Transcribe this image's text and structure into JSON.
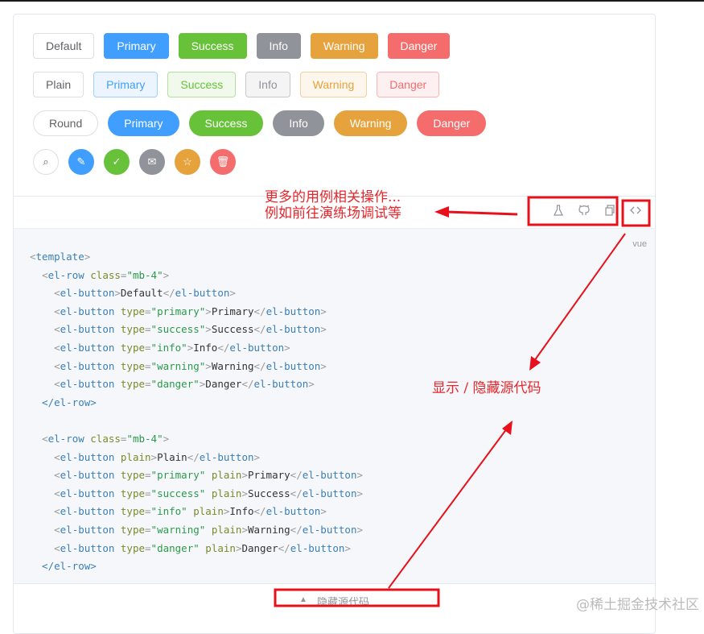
{
  "rows": [
    {
      "kind": "default",
      "buttons": [
        "Default",
        "Primary",
        "Success",
        "Info",
        "Warning",
        "Danger"
      ]
    },
    {
      "kind": "plain",
      "buttons": [
        "Plain",
        "Primary",
        "Success",
        "Info",
        "Warning",
        "Danger"
      ]
    },
    {
      "kind": "round",
      "buttons": [
        "Round",
        "Primary",
        "Success",
        "Info",
        "Warning",
        "Danger"
      ]
    }
  ],
  "circle_icons": [
    "search-icon",
    "edit-icon",
    "check-icon",
    "message-icon",
    "star-icon",
    "delete-icon"
  ],
  "colors": {
    "primary": "#409eff",
    "success": "#67c23a",
    "info": "#909399",
    "warning": "#e6a23c",
    "danger": "#f56c6c",
    "annotation": "#e8262b"
  },
  "toolbar": {
    "icons": [
      "playground-flask-icon",
      "github-icon",
      "copy-icon",
      "code-toggle-icon"
    ]
  },
  "code": {
    "lang": "vue",
    "lines": [
      "<template>",
      "  <el-row class=\"mb-4\">",
      "    <el-button>Default</el-button>",
      "    <el-button type=\"primary\">Primary</el-button>",
      "    <el-button type=\"success\">Success</el-button>",
      "    <el-button type=\"info\">Info</el-button>",
      "    <el-button type=\"warning\">Warning</el-button>",
      "    <el-button type=\"danger\">Danger</el-button>",
      "  </el-row>",
      "",
      "  <el-row class=\"mb-4\">",
      "    <el-button plain>Plain</el-button>",
      "    <el-button type=\"primary\" plain>Primary</el-button>",
      "    <el-button type=\"success\" plain>Success</el-button>",
      "    <el-button type=\"info\" plain>Info</el-button>",
      "    <el-button type=\"warning\" plain>Warning</el-button>",
      "    <el-button type=\"danger\" plain>Danger</el-button>",
      "  </el-row>"
    ]
  },
  "footer": {
    "hide_label": "隐藏源代码"
  },
  "annotations": {
    "more_line1": "更多的用例相关操作...",
    "more_line2": "例如前往演练场调试等",
    "toggle": "显示 / 隐藏源代码"
  },
  "watermark": "@稀土掘金技术社区"
}
